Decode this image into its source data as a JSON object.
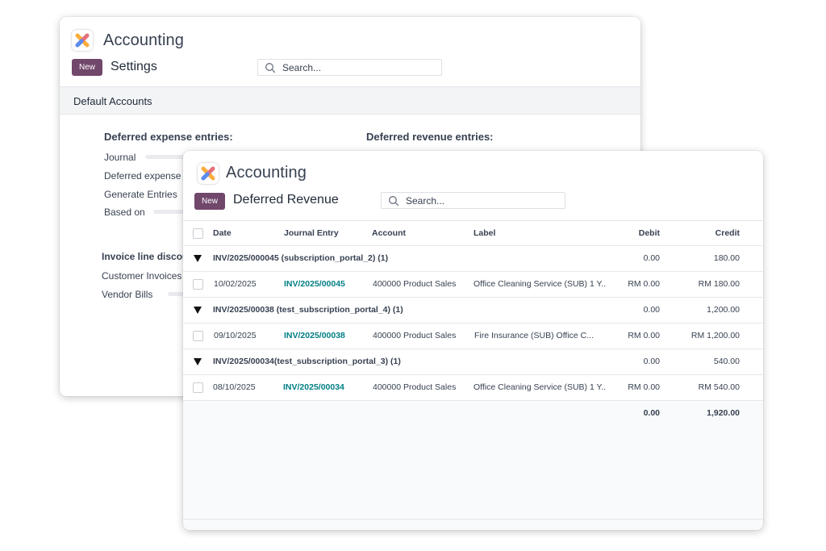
{
  "back_window": {
    "app_title": "Accounting",
    "new_label": "New",
    "page_title": "Settings",
    "search_placeholder": "Search...",
    "section_title": "Default Accounts",
    "deferred_expense_heading": "Deferred expense entries:",
    "deferred_revenue_heading": "Deferred revenue entries:",
    "expense_fields": [
      "Journal",
      "Deferred expense",
      "Generate Entries",
      "Based on"
    ],
    "invoice_discount_heading": "Invoice line discounts:",
    "invoice_discount_fields": [
      "Customer Invoices",
      "Vendor Bills"
    ]
  },
  "front_window": {
    "app_title": "Accounting",
    "new_label": "New",
    "page_title": "Deferred Revenue",
    "search_placeholder": "Search...",
    "columns": {
      "date": "Date",
      "journal_entry": "Journal Entry",
      "account": "Account",
      "label": "Label",
      "debit": "Debit",
      "credit": "Credit"
    },
    "groups": [
      {
        "title": "INV/2025/000045 (subscription_portal_2) (1)",
        "debit": "0.00",
        "credit": "180.00",
        "line": {
          "date": "10/02/2025",
          "journal_entry": "INV/2025/00045",
          "account": "400000 Product Sales",
          "label": "Office Cleaning Service (SUB) 1 Y...",
          "debit": "RM 0.00",
          "credit": "RM 180.00"
        }
      },
      {
        "title": "INV/2025/00038 (test_subscription_portal_4) (1)",
        "debit": "0.00",
        "credit": "1,200.00",
        "line": {
          "date": "09/10/2025",
          "journal_entry": "INV/2025/00038",
          "account": "400000 Product Sales",
          "label": "Fire Insurance (SUB) Office C...",
          "debit": "RM 0.00",
          "credit": "RM 1,200.00"
        }
      },
      {
        "title": "INV/2025/00034(test_subscription_portal_3) (1)",
        "debit": "0.00",
        "credit": "540.00",
        "line": {
          "date": "08/10/2025",
          "journal_entry": "INV/2025/00034",
          "account": "400000 Product Sales",
          "label": "Office Cleaning Service (SUB) 1 Y...",
          "debit": "RM 0.00",
          "credit": "RM 540.00"
        }
      }
    ],
    "totals": {
      "debit": "0.00",
      "credit": "1,920.00"
    }
  },
  "colors": {
    "primary": "#71476b",
    "link": "#017e84"
  }
}
